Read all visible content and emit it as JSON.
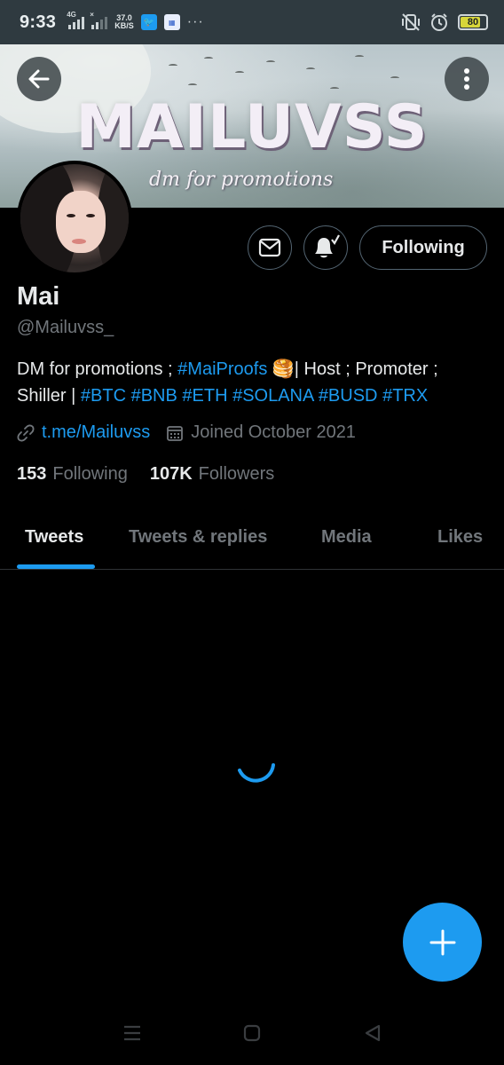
{
  "status_bar": {
    "time": "9:33",
    "net1": "4G",
    "speed_value": "37.0",
    "speed_unit": "KB/S",
    "battery_level": "80",
    "battery_fraction": 0.8,
    "overflow": "···"
  },
  "banner": {
    "title": "MAILUVSS",
    "subtitle": "dm for promotions"
  },
  "profile": {
    "name": "Mai",
    "handle": "@Mailuvss_",
    "bio": {
      "part1": "DM for promotions ; ",
      "tag1": "#MaiProofs",
      "emoji": " 🥞",
      "part2": "| Host ; Promoter ; Shiller | ",
      "tags": [
        "#BTC",
        "#BNB",
        "#ETH",
        "#SOLANA",
        "#BUSD",
        "#TRX"
      ]
    },
    "link": "t.me/Mailuvss",
    "joined": "Joined October 2021",
    "following_count": "153",
    "following_label": "Following",
    "followers_count": "107K",
    "followers_label": "Followers"
  },
  "actions": {
    "following_button": "Following"
  },
  "tabs": [
    {
      "label": "Tweets",
      "active": true
    },
    {
      "label": "Tweets & replies",
      "active": false
    },
    {
      "label": "Media",
      "active": false
    },
    {
      "label": "Likes",
      "active": false
    }
  ],
  "colors": {
    "accent": "#1d9bf0",
    "background": "#000000",
    "secondary_text": "#71767b",
    "status_bar": "#2f3a40"
  },
  "icons": {
    "back": "arrow-left-icon",
    "more": "more-vertical-icon",
    "dm": "envelope-icon",
    "notifications": "bell-check-icon",
    "link": "link-icon",
    "joined": "calendar-icon",
    "fab": "plus-icon",
    "loading": "spinner-icon"
  }
}
